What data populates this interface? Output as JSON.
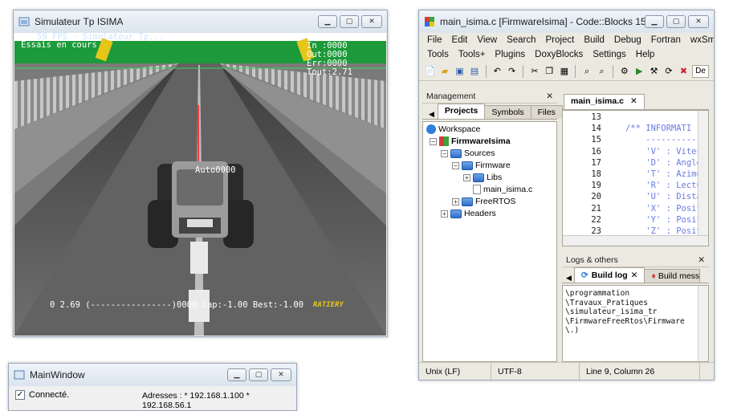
{
  "simulator": {
    "title": "Simulateur Tp ISIMA",
    "hud_fps": "59 FPS - Simulateur Tp...",
    "hud_time": "16.38",
    "hud_status": "Essais en cours",
    "hud_in": "In :0000",
    "hud_out": "Out:0000",
    "hud_err": "Err:0000",
    "hud_tout": "Tout:2.71",
    "car_label": "Auto0000",
    "bottom_line": "0 2.69 (----------------)0000 Lap:-1.00 Best:-1.00",
    "logo": "RATIERY"
  },
  "codeblocks": {
    "title": "main_isima.c [FirmwareIsima] - Code::Blocks 15.12",
    "menu1": [
      "File",
      "Edit",
      "View",
      "Search",
      "Project",
      "Build",
      "Debug",
      "Fortran",
      "wxSmith"
    ],
    "menu2": [
      "Tools",
      "Tools+",
      "Plugins",
      "DoxyBlocks",
      "Settings",
      "Help"
    ],
    "toolbar_icons": [
      "new-file",
      "open",
      "save",
      "save-all",
      "undo",
      "redo",
      "cut",
      "copy",
      "paste",
      "find",
      "replace",
      "gear",
      "build",
      "run",
      "build-run",
      "rebuild",
      "stop"
    ],
    "toolbar_clip": "De",
    "management": {
      "title": "Management",
      "tabs": [
        "Projects",
        "Symbols",
        "Files"
      ],
      "tree": {
        "workspace": "Workspace",
        "project": "FirmwareIsima",
        "sources": "Sources",
        "firmware": "Firmware",
        "libs": "Libs",
        "file": "main_isima.c",
        "freertos": "FreeRTOS",
        "headers": "Headers"
      }
    },
    "editor": {
      "tab": "main_isima.c",
      "lines": [
        {
          "n": "13",
          "t": ""
        },
        {
          "n": "14",
          "t": "/** INFORMATI"
        },
        {
          "n": "15",
          "t": "    ----------"
        },
        {
          "n": "16",
          "t": "    'V' : Vitess"
        },
        {
          "n": "17",
          "t": "    'D' : Angle g"
        },
        {
          "n": "18",
          "t": "    'T' : Azimut"
        },
        {
          "n": "19",
          "t": "    'R' : Lecture"
        },
        {
          "n": "20",
          "t": "    'U' : Distanc"
        },
        {
          "n": "21",
          "t": "    'X' : Positio"
        },
        {
          "n": "22",
          "t": "    'Y' : Positio"
        },
        {
          "n": "23",
          "t": "    'Z' : Positio"
        }
      ]
    },
    "logs": {
      "title": "Logs & others",
      "tab_build_log": "Build log",
      "tab_build_msg": "Build messa",
      "lines": [
        "\\programmation",
        "\\Travaux_Pratiques",
        "\\simulateur_isima_tr",
        "\\FirmwareFreeRtos\\Firmware",
        "\\.)"
      ]
    },
    "status": {
      "eol": "Unix (LF)",
      "encoding": "UTF-8",
      "position": "Line 9, Column 26"
    }
  },
  "mainwindow": {
    "title": "MainWindow",
    "checkbox_label": "Connecté.",
    "checked": true,
    "addresses": "Adresses : * 192.168.1.100 * 192.168.56.1"
  },
  "colors": {
    "sky": "#ffffff",
    "grass": "#1d9a3a",
    "road": "#5a5a5a",
    "accent": "#6a7be0"
  }
}
